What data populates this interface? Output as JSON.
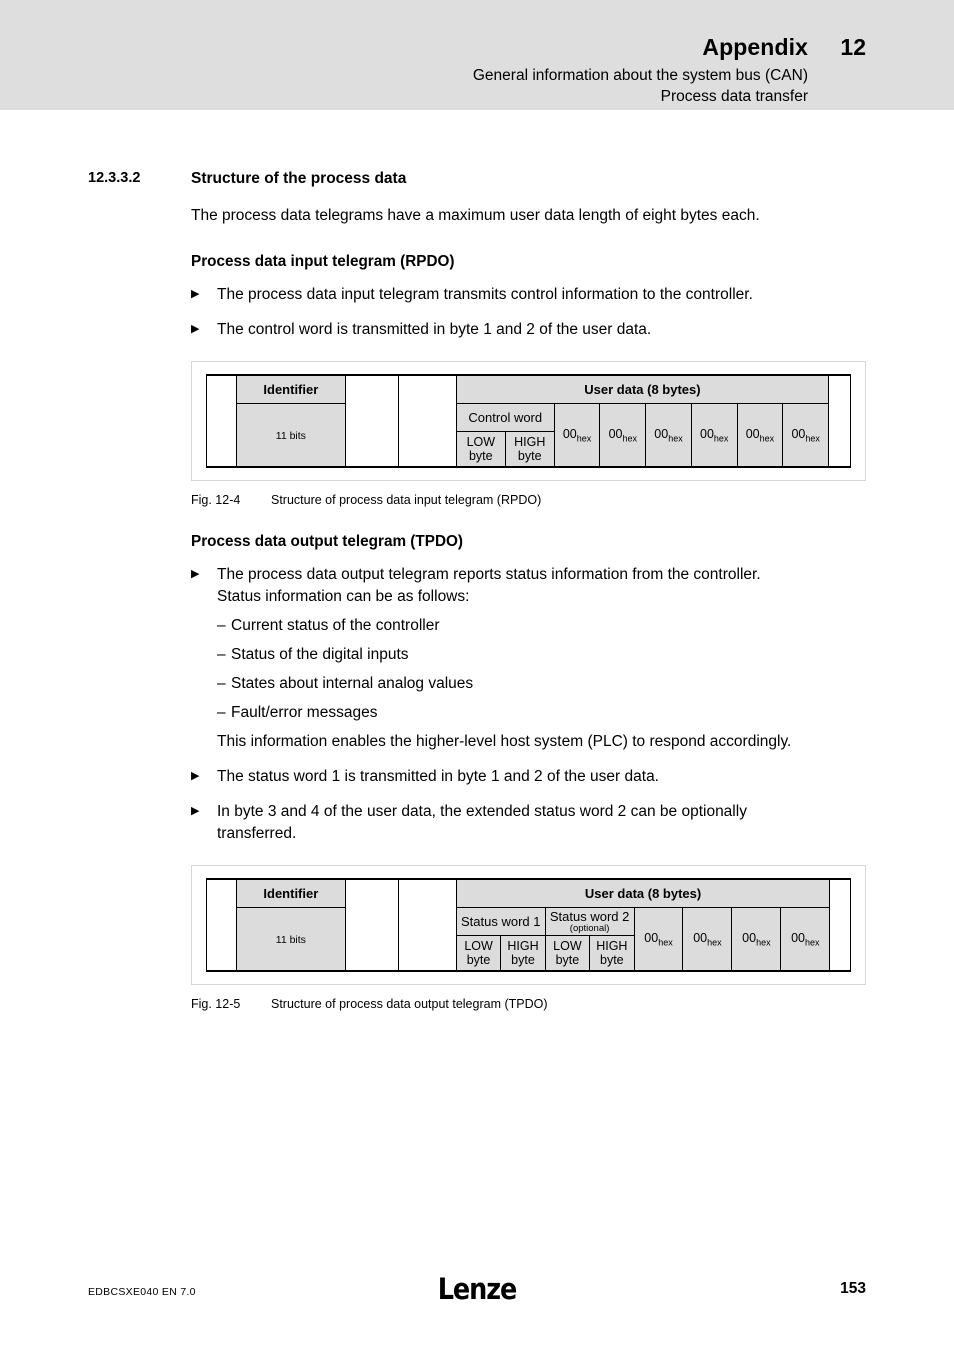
{
  "header": {
    "appendix_title": "Appendix",
    "chapter_number": "12",
    "subtitle_line1": "General information about the system bus (CAN)",
    "subtitle_line2": "Process data transfer",
    "band_color": "#dedede"
  },
  "section": {
    "number": "12.3.3.2",
    "title": "Structure of the process data",
    "intro": "The process data telegrams have a maximum user data length of eight bytes each."
  },
  "rpdo": {
    "heading": "Process data input telegram (RPDO)",
    "bullets": [
      "The process data input telegram transmits control information to the controller.",
      "The control word is transmitted in byte 1 and 2 of the user data."
    ],
    "bullet_marker": "▶",
    "table": {
      "identifier_label": "Identifier",
      "identifier_bits": "11 bits",
      "user_data_label": "User data (8 bytes)",
      "word_label": "Control word",
      "low_byte": "LOW byte",
      "high_byte": "HIGH byte",
      "hex_value": "00",
      "hex_sub": "hex",
      "hex_count": 6
    },
    "caption_number": "Fig. 12-4",
    "caption_text": "Structure of process data input telegram (RPDO)"
  },
  "tpdo": {
    "heading": "Process data output telegram (TPDO)",
    "bullet1_line1": "The process data output telegram reports status information from the controller.",
    "bullet1_line2": "Status information can be as follows:",
    "dash_marker": "–",
    "dash_items": [
      "Current status of the controller",
      "Status of the digital inputs",
      "States about internal analog values",
      "Fault/error messages"
    ],
    "bullet1_closing": "This information enables the higher-level host system (PLC) to respond accordingly.",
    "bullet2": "The status word 1 is transmitted in byte 1 and 2 of the user data.",
    "bullet3_line1": "In byte 3 and 4 of the user data, the extended status word 2 can be optionally",
    "bullet3_line2": "transferred.",
    "table": {
      "identifier_label": "Identifier",
      "identifier_bits": "11 bits",
      "user_data_label": "User data (8 bytes)",
      "word1_label": "Status word 1",
      "word2_label": "Status word 2",
      "word2_optional": "(optional)",
      "low_byte": "LOW byte",
      "high_byte": "HIGH byte",
      "hex_value": "00",
      "hex_sub": "hex",
      "hex_count": 4
    },
    "caption_number": "Fig. 12-5",
    "caption_text": "Structure of process data output telegram (TPDO)"
  },
  "footer": {
    "document_id": "EDBCSXE040  EN  7.0",
    "brand": "Lenze",
    "page_number": "153"
  }
}
